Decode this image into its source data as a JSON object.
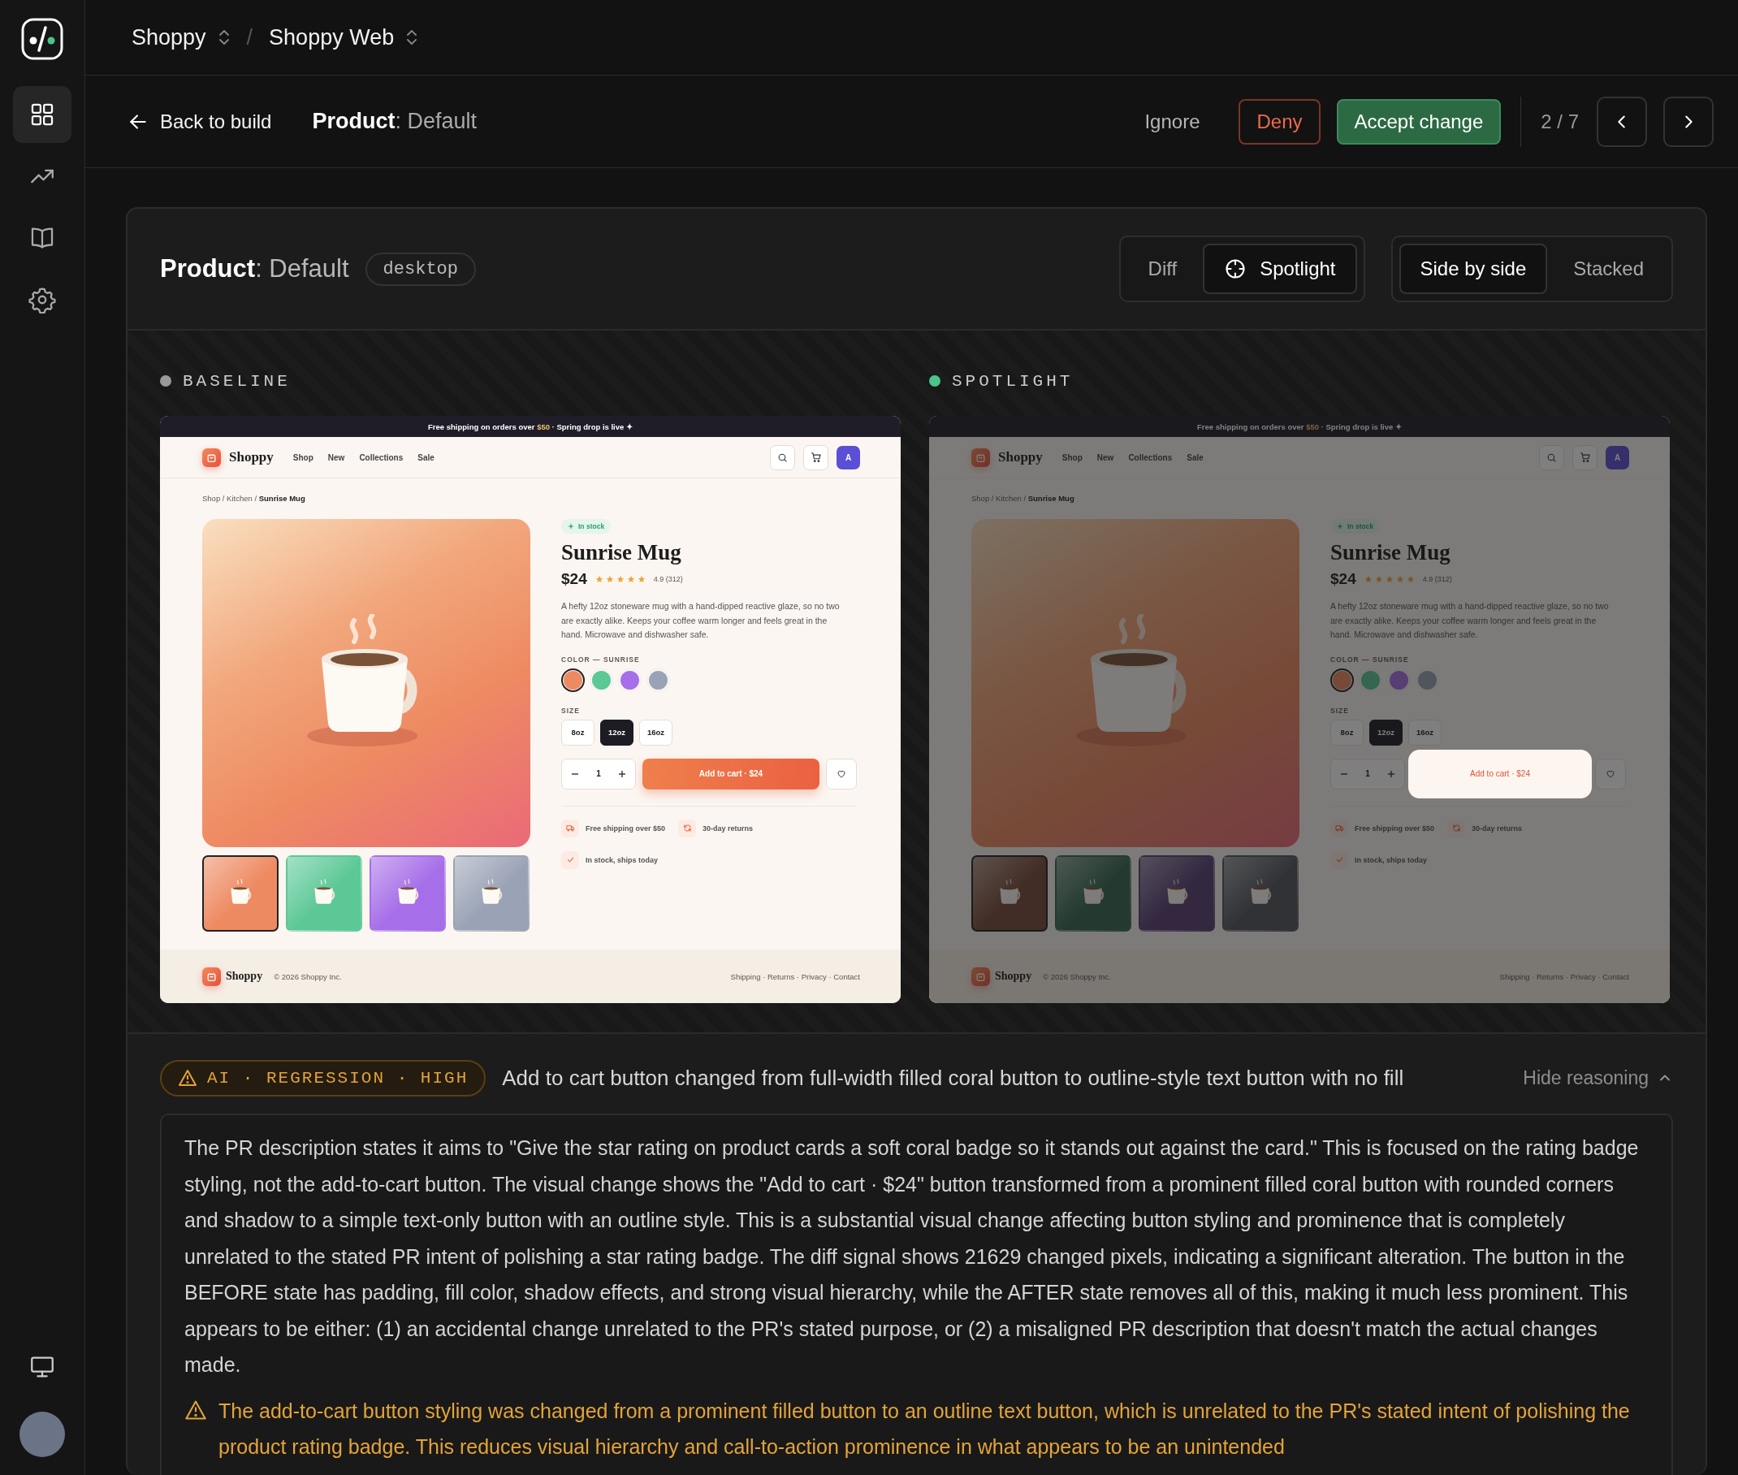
{
  "sidebar": {
    "items": [
      {
        "kind": "grid",
        "selected": true
      },
      {
        "kind": "trend",
        "selected": false
      },
      {
        "kind": "book",
        "selected": false
      },
      {
        "kind": "gear",
        "selected": false
      }
    ],
    "bottom": [
      {
        "kind": "monitor",
        "selected": false
      }
    ]
  },
  "breadcrumb": {
    "separator": "/",
    "items": [
      "Shoppy",
      "Shoppy Web"
    ]
  },
  "toolbar": {
    "back": "Back to build",
    "title": "**Product**: Default",
    "actions": [
      {
        "label": "Ignore",
        "kind": "ghost"
      },
      {
        "label": "Deny",
        "kind": "danger"
      },
      {
        "label": "Accept change",
        "kind": "primary"
      }
    ],
    "pager": "2 / 7"
  },
  "card": {
    "title": "**Product**: Default",
    "tag": "desktop",
    "modes": [
      {
        "label": "Diff",
        "selected": false,
        "icon": false
      },
      {
        "label": "Spotlight",
        "selected": true,
        "icon": true
      }
    ],
    "layouts": [
      {
        "label": "Side by side",
        "selected": true
      },
      {
        "label": "Stacked",
        "selected": false
      }
    ]
  },
  "panels": [
    {
      "label": "BASELINE",
      "kind": "baseline",
      "color": "#9a9a9a",
      "mockup": {
        "banner": "Free shipping on orders over **$50** · Spring drop is live ✦",
        "brand": "Shoppy",
        "nav": [
          "Shop",
          "New",
          "Collections",
          "Sale"
        ],
        "avatar": "A",
        "crumbs": "Shop / Kitchen / **Sunrise Mug**",
        "stock": "In stock",
        "title": "Sunrise Mug",
        "price": "$24",
        "stars": 5,
        "rating": "4.9 (312)",
        "description": "A hefty 12oz stoneware mug with a hand-dipped reactive glaze, so no two are exactly alike. Keeps your coffee warm longer and feels great in the hand. Microwave and dishwasher safe.",
        "color_label": "COLOR — SUNRISE",
        "swatches": [
          {
            "color": "#ee8a62",
            "selected": true
          },
          {
            "color": "#5cc896",
            "selected": false
          },
          {
            "color": "#a66ee8",
            "selected": false
          },
          {
            "color": "#9aa3b5",
            "selected": false
          }
        ],
        "size_label": "SIZE",
        "sizes": [
          {
            "label": "8oz",
            "selected": false
          },
          {
            "label": "12oz",
            "selected": true
          },
          {
            "label": "16oz",
            "selected": false
          }
        ],
        "quantity": "1",
        "add_to_cart": "Add to cart · $24",
        "features": [
          {
            "kind": "truck",
            "label": "Free shipping over $50"
          },
          {
            "kind": "refresh",
            "label": "30-day returns"
          },
          {
            "kind": "check",
            "label": "In stock, ships today"
          }
        ],
        "thumbnails": [
          {
            "selected": true
          },
          {
            "selected": false
          },
          {
            "selected": false
          },
          {
            "selected": false
          }
        ],
        "footer_brand": "Shoppy",
        "copyright": "© 2026 Shoppy Inc.",
        "footer_links": "Shipping · Returns · Privacy · Contact"
      }
    },
    {
      "label": "SPOTLIGHT",
      "kind": "spotlight",
      "color": "#4cc38a",
      "mockup": {
        "banner": "Free shipping on orders over **$50** · Spring drop is live ✦",
        "brand": "Shoppy",
        "nav": [
          "Shop",
          "New",
          "Collections",
          "Sale"
        ],
        "avatar": "A",
        "crumbs": "Shop / Kitchen / **Sunrise Mug**",
        "stock": "In stock",
        "title": "Sunrise Mug",
        "price": "$24",
        "stars": 5,
        "rating": "4.9 (312)",
        "description": "A hefty 12oz stoneware mug with a hand-dipped reactive glaze, so no two are exactly alike. Keeps your coffee warm longer and feels great in the hand. Microwave and dishwasher safe.",
        "color_label": "COLOR — SUNRISE",
        "swatches": [
          {
            "color": "#774a38",
            "selected": true
          },
          {
            "color": "#356650",
            "selected": false
          },
          {
            "color": "#573e74",
            "selected": false
          },
          {
            "color": "#51555d",
            "selected": false
          }
        ],
        "size_label": "SIZE",
        "sizes": [
          {
            "label": "8oz",
            "selected": false
          },
          {
            "label": "12oz",
            "selected": true
          },
          {
            "label": "16oz",
            "selected": false
          }
        ],
        "quantity": "1",
        "add_to_cart": "Add to cart · $24",
        "features": [
          {
            "kind": "truck",
            "label": "Free shipping over $50"
          },
          {
            "kind": "refresh",
            "label": "30-day returns"
          },
          {
            "kind": "check",
            "label": "In stock, ships today"
          }
        ],
        "thumbnails": [
          {
            "selected": true
          },
          {
            "selected": false
          },
          {
            "selected": false
          },
          {
            "selected": false
          }
        ],
        "footer_brand": "Shoppy",
        "copyright": "© 2026 Shoppy Inc.",
        "footer_links": "Shipping · Returns · Privacy · Contact"
      }
    }
  ],
  "finding": {
    "badge": "AI · REGRESSION · HIGH",
    "summary": "Add to cart button changed from full-width filled coral button to outline-style text button with no fill",
    "toggle": "Hide reasoning",
    "expanded": true,
    "reasoning": "The PR description states it aims to \"Give the star rating on product cards a soft coral badge so it stands out against the card.\" This is focused on the rating badge styling, not the add-to-cart button. The visual change shows the \"Add to cart · $24\" button transformed from a prominent filled coral button with rounded corners and shadow to a simple text-only button with an outline style. This is a substantial visual change affecting button styling and prominence that is completely unrelated to the stated PR intent of polishing a star rating badge. The diff signal shows 21629 changed pixels, indicating a significant alteration. The button in the BEFORE state has padding, fill color, shadow effects, and strong visual hierarchy, while the AFTER state removes all of this, making it much less prominent. This appears to be either: (1) an accidental change unrelated to the PR's stated purpose, or (2) a misaligned PR description that doesn't match the actual changes made.",
    "warning": "The add-to-cart button styling was changed from a prominent filled button to an outline text button, which is unrelated to the PR's stated intent of polishing the product rating badge. This reduces visual hierarchy and call-to-action prominence in what appears to be an unintended"
  }
}
